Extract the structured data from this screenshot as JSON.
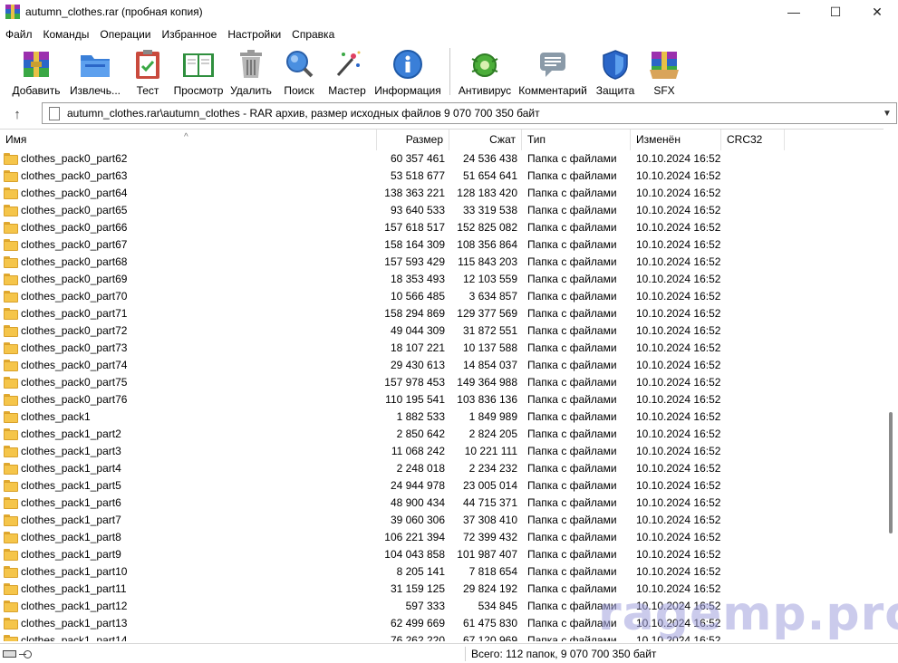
{
  "window": {
    "title": "autumn_clothes.rar (пробная копия)",
    "controls": {
      "minimize": "—",
      "maximize": "☐",
      "close": "✕"
    }
  },
  "menu": [
    "Файл",
    "Команды",
    "Операции",
    "Избранное",
    "Настройки",
    "Справка"
  ],
  "toolbar": [
    {
      "label": "Добавить",
      "icon": "add-archive-icon"
    },
    {
      "label": "Извлечь...",
      "icon": "extract-folder-icon"
    },
    {
      "label": "Тест",
      "icon": "test-clipboard-icon"
    },
    {
      "label": "Просмотр",
      "icon": "view-book-icon"
    },
    {
      "label": "Удалить",
      "icon": "trash-icon"
    },
    {
      "label": "Поиск",
      "icon": "search-icon"
    },
    {
      "label": "Мастер",
      "icon": "wizard-wand-icon"
    },
    {
      "label": "Информация",
      "icon": "info-icon"
    },
    {
      "label": "Антивирус",
      "icon": "antivirus-bug-icon"
    },
    {
      "label": "Комментарий",
      "icon": "comment-icon"
    },
    {
      "label": "Защита",
      "icon": "shield-icon"
    },
    {
      "label": "SFX",
      "icon": "sfx-box-icon"
    }
  ],
  "address": {
    "path": "autumn_clothes.rar\\autumn_clothes - RAR архив, размер исходных файлов 9 070 700 350 байт"
  },
  "columns": {
    "name": "Имя",
    "size": "Размер",
    "packed": "Сжат",
    "type": "Тип",
    "modified": "Изменён",
    "crc": "CRC32"
  },
  "rows": [
    {
      "name": "clothes_pack0_part62",
      "size": "60 357 461",
      "packed": "24 536 438",
      "type": "Папка с файлами",
      "modified": "10.10.2024 16:52"
    },
    {
      "name": "clothes_pack0_part63",
      "size": "53 518 677",
      "packed": "51 654 641",
      "type": "Папка с файлами",
      "modified": "10.10.2024 16:52"
    },
    {
      "name": "clothes_pack0_part64",
      "size": "138 363 221",
      "packed": "128 183 420",
      "type": "Папка с файлами",
      "modified": "10.10.2024 16:52"
    },
    {
      "name": "clothes_pack0_part65",
      "size": "93 640 533",
      "packed": "33 319 538",
      "type": "Папка с файлами",
      "modified": "10.10.2024 16:52"
    },
    {
      "name": "clothes_pack0_part66",
      "size": "157 618 517",
      "packed": "152 825 082",
      "type": "Папка с файлами",
      "modified": "10.10.2024 16:52"
    },
    {
      "name": "clothes_pack0_part67",
      "size": "158 164 309",
      "packed": "108 356 864",
      "type": "Папка с файлами",
      "modified": "10.10.2024 16:52"
    },
    {
      "name": "clothes_pack0_part68",
      "size": "157 593 429",
      "packed": "115 843 203",
      "type": "Папка с файлами",
      "modified": "10.10.2024 16:52"
    },
    {
      "name": "clothes_pack0_part69",
      "size": "18 353 493",
      "packed": "12 103 559",
      "type": "Папка с файлами",
      "modified": "10.10.2024 16:52"
    },
    {
      "name": "clothes_pack0_part70",
      "size": "10 566 485",
      "packed": "3 634 857",
      "type": "Папка с файлами",
      "modified": "10.10.2024 16:52"
    },
    {
      "name": "clothes_pack0_part71",
      "size": "158 294 869",
      "packed": "129 377 569",
      "type": "Папка с файлами",
      "modified": "10.10.2024 16:52"
    },
    {
      "name": "clothes_pack0_part72",
      "size": "49 044 309",
      "packed": "31 872 551",
      "type": "Папка с файлами",
      "modified": "10.10.2024 16:52"
    },
    {
      "name": "clothes_pack0_part73",
      "size": "18 107 221",
      "packed": "10 137 588",
      "type": "Папка с файлами",
      "modified": "10.10.2024 16:52"
    },
    {
      "name": "clothes_pack0_part74",
      "size": "29 430 613",
      "packed": "14 854 037",
      "type": "Папка с файлами",
      "modified": "10.10.2024 16:52"
    },
    {
      "name": "clothes_pack0_part75",
      "size": "157 978 453",
      "packed": "149 364 988",
      "type": "Папка с файлами",
      "modified": "10.10.2024 16:52"
    },
    {
      "name": "clothes_pack0_part76",
      "size": "110 195 541",
      "packed": "103 836 136",
      "type": "Папка с файлами",
      "modified": "10.10.2024 16:52"
    },
    {
      "name": "clothes_pack1",
      "size": "1 882 533",
      "packed": "1 849 989",
      "type": "Папка с файлами",
      "modified": "10.10.2024 16:52"
    },
    {
      "name": "clothes_pack1_part2",
      "size": "2 850 642",
      "packed": "2 824 205",
      "type": "Папка с файлами",
      "modified": "10.10.2024 16:52"
    },
    {
      "name": "clothes_pack1_part3",
      "size": "11 068 242",
      "packed": "10 221 111",
      "type": "Папка с файлами",
      "modified": "10.10.2024 16:52"
    },
    {
      "name": "clothes_pack1_part4",
      "size": "2 248 018",
      "packed": "2 234 232",
      "type": "Папка с файлами",
      "modified": "10.10.2024 16:52"
    },
    {
      "name": "clothes_pack1_part5",
      "size": "24 944 978",
      "packed": "23 005 014",
      "type": "Папка с файлами",
      "modified": "10.10.2024 16:52"
    },
    {
      "name": "clothes_pack1_part6",
      "size": "48 900 434",
      "packed": "44 715 371",
      "type": "Папка с файлами",
      "modified": "10.10.2024 16:52"
    },
    {
      "name": "clothes_pack1_part7",
      "size": "39 060 306",
      "packed": "37 308 410",
      "type": "Папка с файлами",
      "modified": "10.10.2024 16:52"
    },
    {
      "name": "clothes_pack1_part8",
      "size": "106 221 394",
      "packed": "72 399 432",
      "type": "Папка с файлами",
      "modified": "10.10.2024 16:52"
    },
    {
      "name": "clothes_pack1_part9",
      "size": "104 043 858",
      "packed": "101 987 407",
      "type": "Папка с файлами",
      "modified": "10.10.2024 16:52"
    },
    {
      "name": "clothes_pack1_part10",
      "size": "8 205 141",
      "packed": "7 818 654",
      "type": "Папка с файлами",
      "modified": "10.10.2024 16:52"
    },
    {
      "name": "clothes_pack1_part11",
      "size": "31 159 125",
      "packed": "29 824 192",
      "type": "Папка с файлами",
      "modified": "10.10.2024 16:52"
    },
    {
      "name": "clothes_pack1_part12",
      "size": "597 333",
      "packed": "534 845",
      "type": "Папка с файлами",
      "modified": "10.10.2024 16:52"
    },
    {
      "name": "clothes_pack1_part13",
      "size": "62 499 669",
      "packed": "61 475 830",
      "type": "Папка с файлами",
      "modified": "10.10.2024 16:52"
    },
    {
      "name": "clothes_pack1_part14",
      "size": "76 262 220",
      "packed": "67 120 969",
      "type": "Папка с файлами",
      "modified": "10.10.2024 16:52"
    }
  ],
  "status": {
    "summary": "Всего: 112 папок, 9 070 700 350 байт"
  },
  "watermark": "ragemp.pro",
  "colors": {
    "folder": "#f5c54a",
    "watermark": "#a0a0dc"
  }
}
